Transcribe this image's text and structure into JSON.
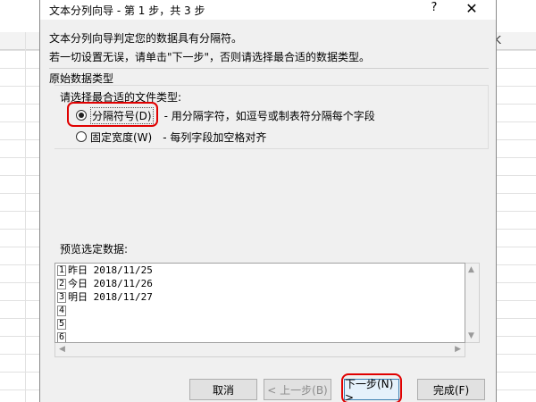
{
  "sheet": {
    "col_k": "K"
  },
  "dialog": {
    "title": "文本分列向导 - 第 1 步，共 3 步",
    "help_glyph": "?",
    "close_glyph": "✕",
    "intro_line1": "文本分列向导判定您的数据具有分隔符。",
    "intro_line2": "若一切设置无误，请单击\"下一步\"，否则请选择最合适的数据类型。",
    "group_title": "原始数据类型",
    "choose_label": "请选择最合适的文件类型:",
    "options": [
      {
        "label": "分隔符号(D)",
        "desc": "- 用分隔字符，如逗号或制表符分隔每个字段",
        "selected": true
      },
      {
        "label": "固定宽度(W)",
        "desc": "- 每列字段加空格对齐",
        "selected": false
      }
    ],
    "preview_label": "预览选定数据:",
    "preview_rows": [
      {
        "num": "1",
        "text": "昨日 2018/11/25"
      },
      {
        "num": "2",
        "text": "今日 2018/11/26"
      },
      {
        "num": "3",
        "text": "明日 2018/11/27"
      },
      {
        "num": "4",
        "text": ""
      },
      {
        "num": "5",
        "text": ""
      },
      {
        "num": "6",
        "text": ""
      }
    ],
    "buttons": {
      "cancel": "取消",
      "prev": "< 上一步(B)",
      "next": "下一步(N) >",
      "finish": "完成(F)"
    },
    "scroll_glyphs": {
      "up": "▲",
      "down": "▼",
      "left": "◀",
      "right": "▶"
    }
  }
}
